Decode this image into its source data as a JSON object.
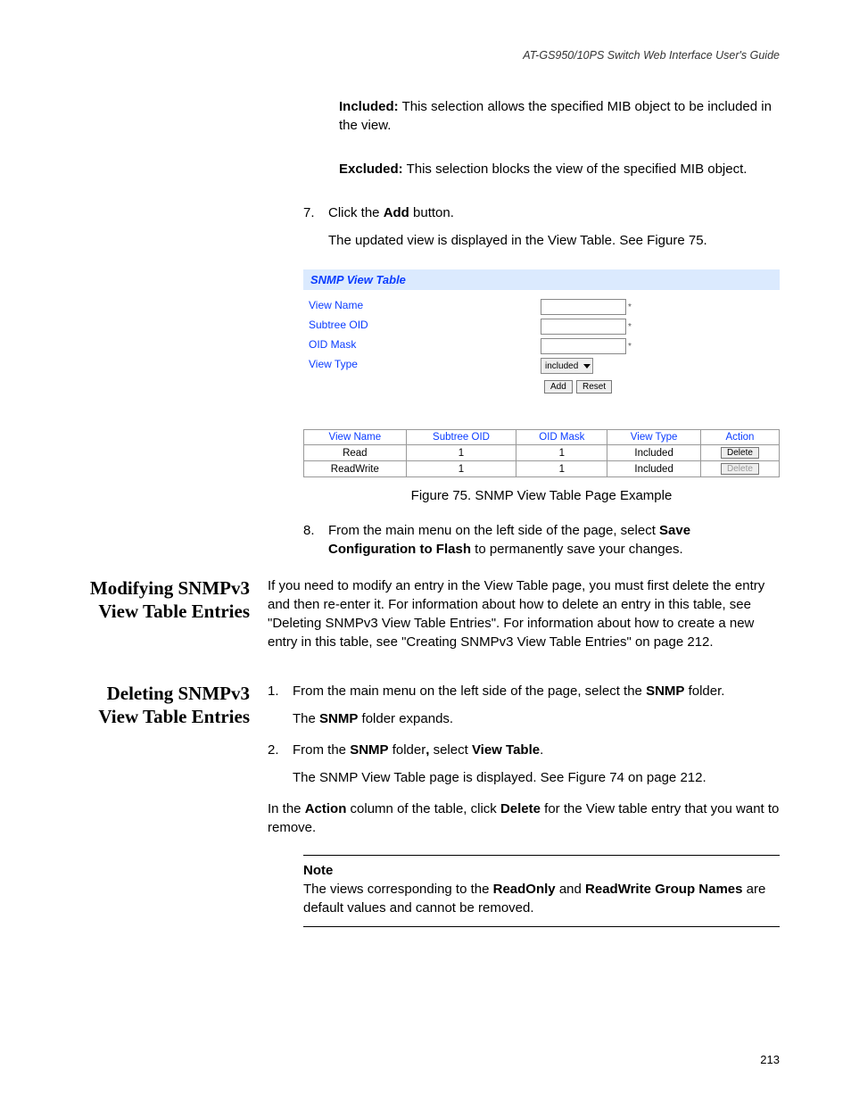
{
  "header": {
    "running_head": "AT-GS950/10PS Switch Web Interface User's Guide"
  },
  "page_number": "213",
  "intro": {
    "included_label": "Included:",
    "included_text": " This selection allows the specified MIB object to be included in the view.",
    "excluded_label": "Excluded:",
    "excluded_text": " This selection blocks the view of the specified MIB object."
  },
  "step7": {
    "num": "7.",
    "pre": "Click the ",
    "bold": "Add",
    "post": " button.",
    "follow": "The updated view is displayed in the View Table. See Figure 75."
  },
  "figure": {
    "title": "SNMP View Table",
    "labels": {
      "view_name": "View Name",
      "subtree_oid": "Subtree OID",
      "oid_mask": "OID Mask",
      "view_type": "View Type"
    },
    "select_value": "included",
    "buttons": {
      "add": "Add",
      "reset": "Reset"
    },
    "table": {
      "headers": [
        "View Name",
        "Subtree OID",
        "OID Mask",
        "View Type",
        "Action"
      ],
      "rows": [
        {
          "cells": [
            "Read",
            "1",
            "1",
            "Included"
          ],
          "action": "Delete",
          "disabled": false
        },
        {
          "cells": [
            "ReadWrite",
            "1",
            "1",
            "Included"
          ],
          "action": "Delete",
          "disabled": true
        }
      ]
    },
    "caption": "Figure 75. SNMP View Table Page Example"
  },
  "step8": {
    "num": "8.",
    "pre": "From the main menu on the left side of the page, select ",
    "b1": "Save Configuration to Flash",
    "post": " to permanently save your changes."
  },
  "section_modify": {
    "heading": "Modifying SNMPv3 View Table Entries",
    "body": "If you need to modify an entry in the View Table page, you must first delete the entry and then re-enter it. For information about how to delete an entry in this table, see \"Deleting SNMPv3 View Table Entries\". For information about how to create a new entry in this table, see \"Creating SNMPv3 View Table Entries\" on page 212."
  },
  "section_delete": {
    "heading": "Deleting SNMPv3 View Table Entries",
    "step1": {
      "num": "1.",
      "pre": "From the main menu on the left side of the page, select the ",
      "b": "SNMP",
      "post": " folder."
    },
    "step1_follow_pre": "The ",
    "step1_follow_b": "SNMP",
    "step1_follow_post": " folder expands.",
    "step2": {
      "num": "2.",
      "pre": "From the ",
      "b1": "SNMP",
      "mid": " folder",
      "comma_b": ",",
      "mid2": " select ",
      "b2": "View Table",
      "post": "."
    },
    "step2_follow": "The SNMP View Table page is displayed. See Figure 74 on page 212.",
    "action_para_pre": "In the ",
    "action_b1": "Action",
    "action_mid": " column of the table, click ",
    "action_b2": "Delete",
    "action_post": " for the View table entry that you want to remove.",
    "note_label": "Note",
    "note_pre": "The views corresponding to the ",
    "note_b1": "ReadOnly",
    "note_mid": " and ",
    "note_b2": "ReadWrite Group Names",
    "note_post": " are default values and cannot be removed."
  }
}
